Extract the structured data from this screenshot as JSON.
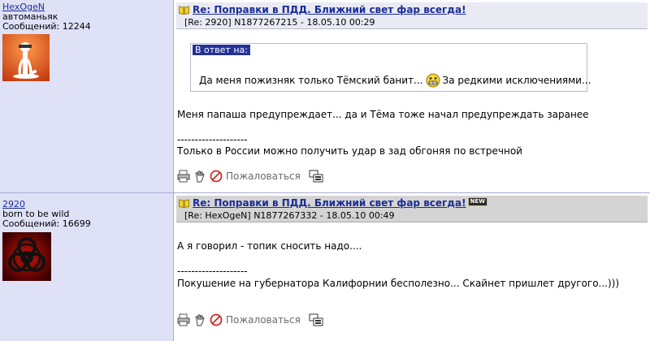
{
  "posts": [
    {
      "author": {
        "nick": "HexOgeN",
        "status": "автоманьяк",
        "count_label": "Сообщений: 12244"
      },
      "title": "Re: Поправки в ПДД. Ближний свет фар всегда!",
      "meta": "[Re: 2920]  N1877267215 - 18.05.10 00:29",
      "quote": {
        "label": "В ответ на:",
        "text_before": "Да меня пожизняк только Тёмский банит...",
        "text_after": "За редкими исключениями..."
      },
      "body": "Меня папаша предупреждает... да и Тёма тоже начал предупреждать заранее",
      "signature_sep": "--------------------",
      "signature": "Только в России можно получить удар в зад обгоняя по встречной",
      "complain_label": "Пожаловаться"
    },
    {
      "author": {
        "nick": "2920",
        "status": "born to be wild",
        "count_label": "Сообщений: 16699"
      },
      "title": "Re: Поправки в ПДД. Ближний свет фар всегда!",
      "new_badge": "NEW",
      "meta": "[Re: HexOgeN]  N1877267332 - 18.05.10 00:49",
      "body": "А я говорил - топик сносить надо....",
      "signature_sep": "--------------------",
      "signature": "Покушение на губернатора Калифорнии бесполезно... Скайнет пришлет другого...)))",
      "complain_label": "Пожаловаться"
    }
  ],
  "colors": {
    "sidebar_bg": "#dfe1f7",
    "link": "#1a2d96",
    "quote_label_bg": "#25319a"
  }
}
